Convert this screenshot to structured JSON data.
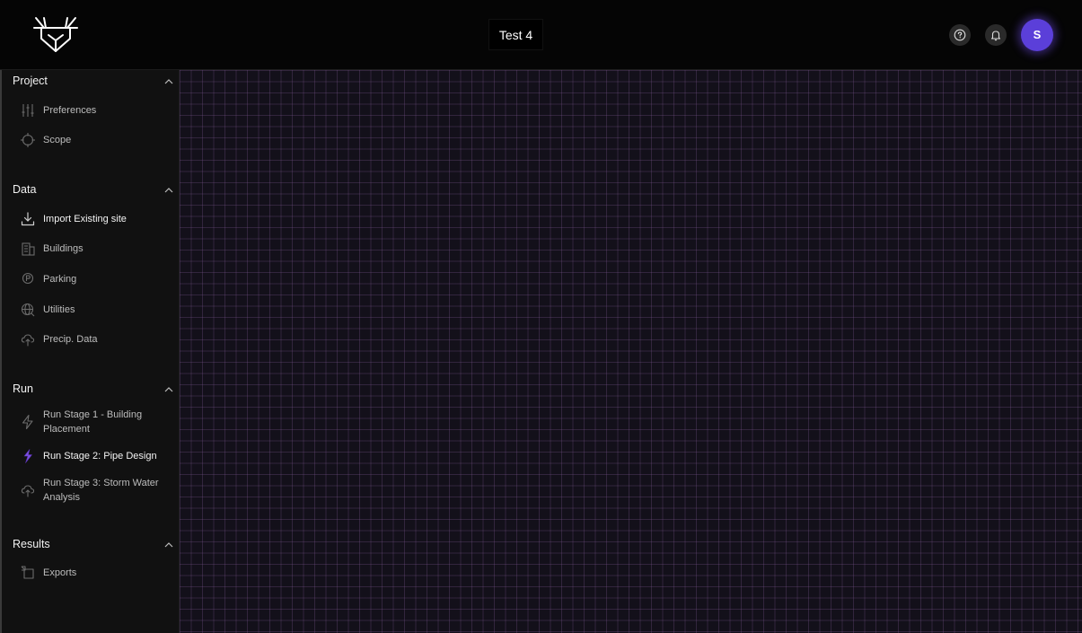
{
  "header": {
    "project_title": "Test 4",
    "avatar_initial": "S",
    "help_icon": "help-circle-icon",
    "bell_icon": "bell-icon",
    "logo_icon": "deer-antler-logo-icon"
  },
  "sidebar": {
    "sections": [
      {
        "title": "Project",
        "items": [
          {
            "label": "Preferences",
            "icon": "sliders-icon"
          },
          {
            "label": "Scope",
            "icon": "crosshair-icon"
          }
        ]
      },
      {
        "title": "Data",
        "items": [
          {
            "label": "Import Existing site",
            "icon": "download-icon"
          },
          {
            "label": "Buildings",
            "icon": "building-icon"
          },
          {
            "label": "Parking",
            "icon": "parking-icon"
          },
          {
            "label": "Utilities",
            "icon": "globe-icon"
          },
          {
            "label": "Precip. Data",
            "icon": "cloud-upload-icon"
          }
        ]
      },
      {
        "title": "Run",
        "items": [
          {
            "label": "Run Stage 1 - Building Placement",
            "icon": "lightning-icon"
          },
          {
            "label": "Run Stage 2: Pipe Design",
            "icon": "lightning-filled-icon"
          },
          {
            "label": "Run Stage 3: Storm Water Analysis",
            "icon": "cloud-upload-icon"
          }
        ]
      },
      {
        "title": "Results",
        "items": [
          {
            "label": "Exports",
            "icon": "export-icon"
          }
        ]
      }
    ]
  },
  "colors": {
    "header_bg": "#050505",
    "sidebar_bg": "#111111",
    "canvas_bg": "#13101a",
    "grid_line": "#825a96",
    "avatar_bg": "#5b3fd9",
    "accent_purple": "#7b4fe0"
  }
}
